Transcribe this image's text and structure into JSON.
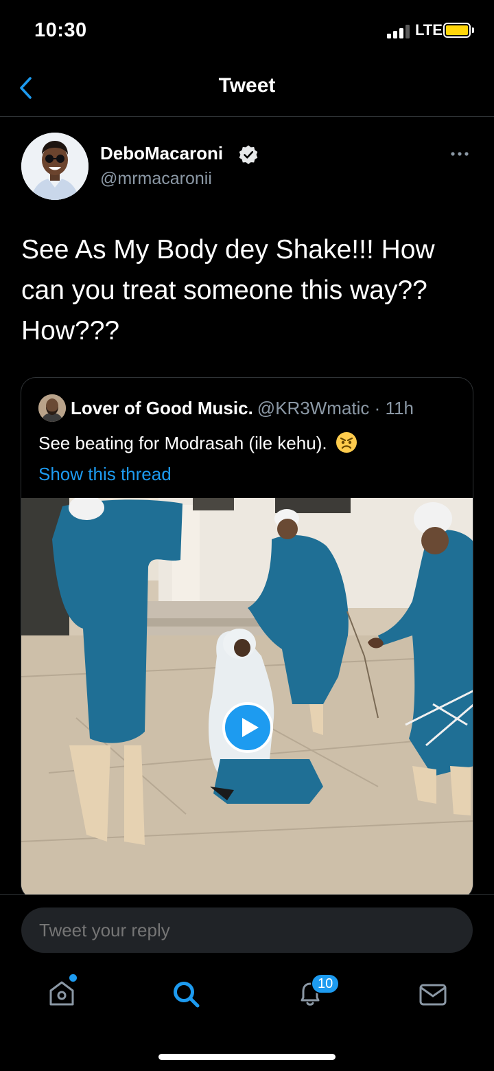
{
  "status_bar": {
    "time": "10:30",
    "network": "LTE",
    "battery_color": "#ffd60a"
  },
  "nav": {
    "title": "Tweet",
    "back_icon": "chevron-left-icon"
  },
  "tweet": {
    "author_name": "DeboMacaroni",
    "author_handle": "@mrmacaronii",
    "verified": true,
    "text": "See As My Body dey Shake!!! How can you treat someone this way?? How???"
  },
  "quote": {
    "author_name": "Lover of Good Music.",
    "meta": "@KR3Wmatic · 11h",
    "text": "See beating for Modrasah (ile kehu).",
    "emoji": "angry-face",
    "link": "Show this thread"
  },
  "reply": {
    "placeholder": "Tweet your reply"
  },
  "tab_bar": {
    "items": [
      "home-icon",
      "search-icon",
      "notifications-icon",
      "messages-icon"
    ],
    "notifications_count": "10",
    "active": "search"
  },
  "colors": {
    "accent": "#1d9bf0",
    "background": "#000000",
    "secondary_text": "#8b98a5"
  }
}
